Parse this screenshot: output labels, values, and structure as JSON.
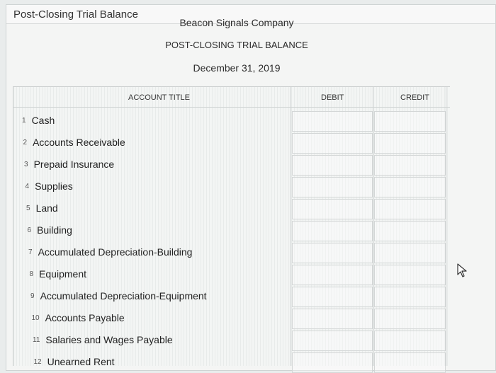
{
  "window": {
    "title": "Post-Closing Trial Balance"
  },
  "header": {
    "company": "Beacon Signals Company",
    "statement": "POST-CLOSING TRIAL BALANCE",
    "date": "December 31, 2019"
  },
  "table": {
    "columns": {
      "account": "ACCOUNT TITLE",
      "debit": "DEBIT",
      "credit": "CREDIT"
    },
    "rows": [
      {
        "num": "1",
        "account": "Cash",
        "debit": "",
        "credit": ""
      },
      {
        "num": "2",
        "account": "Accounts Receivable",
        "debit": "",
        "credit": ""
      },
      {
        "num": "3",
        "account": "Prepaid Insurance",
        "debit": "",
        "credit": ""
      },
      {
        "num": "4",
        "account": "Supplies",
        "debit": "",
        "credit": ""
      },
      {
        "num": "5",
        "account": "Land",
        "debit": "",
        "credit": ""
      },
      {
        "num": "6",
        "account": "Building",
        "debit": "",
        "credit": ""
      },
      {
        "num": "7",
        "account": "Accumulated Depreciation-Building",
        "debit": "",
        "credit": ""
      },
      {
        "num": "8",
        "account": "Equipment",
        "debit": "",
        "credit": ""
      },
      {
        "num": "9",
        "account": "Accumulated Depreciation-Equipment",
        "debit": "",
        "credit": ""
      },
      {
        "num": "10",
        "account": "Accounts Payable",
        "debit": "",
        "credit": ""
      },
      {
        "num": "11",
        "account": "Salaries and Wages Payable",
        "debit": "",
        "credit": ""
      },
      {
        "num": "12",
        "account": "Unearned Rent",
        "debit": "",
        "credit": ""
      }
    ]
  },
  "icons": {
    "cursor": "mouse-pointer-icon"
  }
}
